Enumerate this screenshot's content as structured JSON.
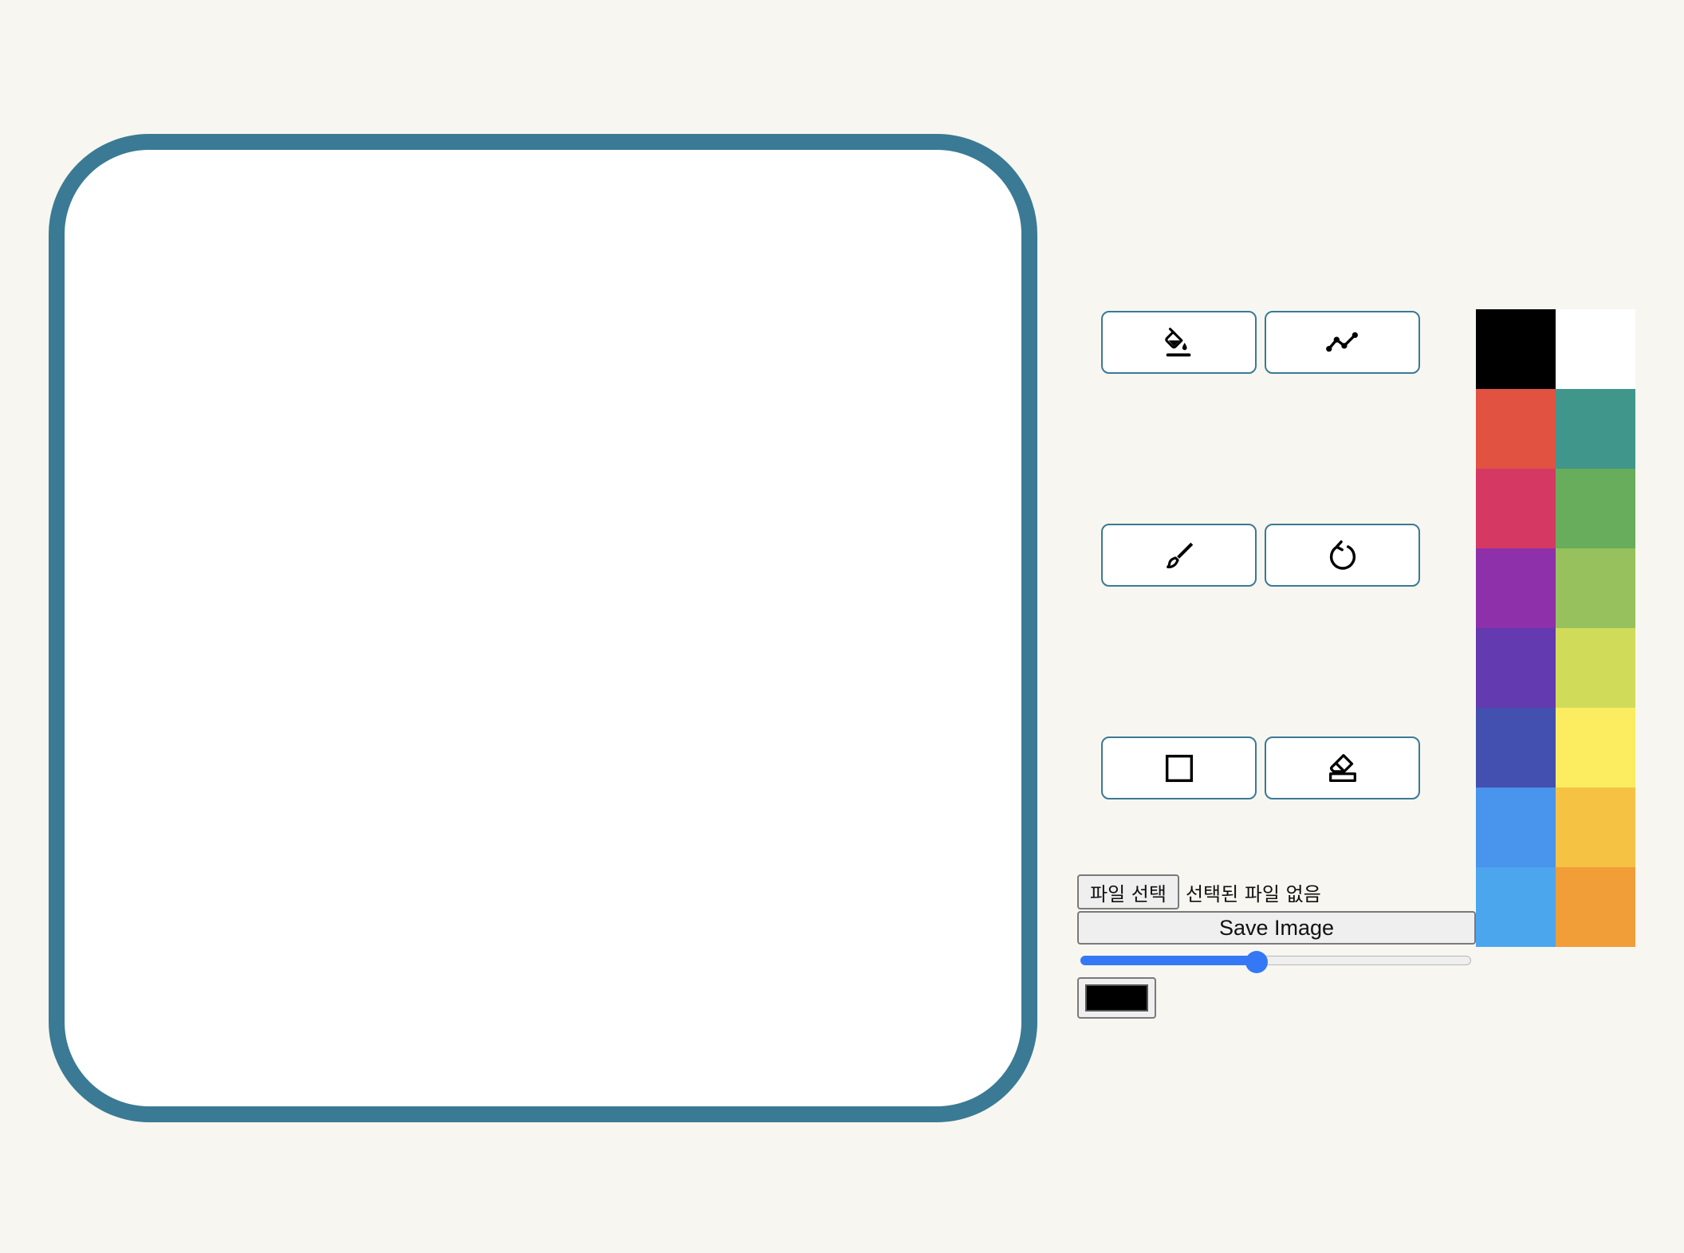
{
  "tools": [
    {
      "name": "fill-tool-button",
      "icon": "paint-bucket-icon"
    },
    {
      "name": "line-tool-button",
      "icon": "polyline-icon"
    },
    {
      "name": "brush-tool-button",
      "icon": "brush-icon"
    },
    {
      "name": "reset-tool-button",
      "icon": "rotate-icon"
    },
    {
      "name": "rectangle-tool-button",
      "icon": "square-icon"
    },
    {
      "name": "eraser-tool-button",
      "icon": "eraser-icon"
    }
  ],
  "file": {
    "button_label": "파일 선택",
    "status": "선택된 파일 없음"
  },
  "save": {
    "label": "Save Image"
  },
  "brush_size": {
    "fraction": 0.45
  },
  "current_color": "#000000",
  "canvas": {
    "border_color": "#3a7a95",
    "background": "#ffffff"
  },
  "palette": [
    "#000000",
    "#ffffff",
    "#e15241",
    "#41968c",
    "#d63864",
    "#67ad5b",
    "#8e30aa",
    "#97c15c",
    "#643ab0",
    "#d0dc59",
    "#4350af",
    "#fcec60",
    "#4994ec",
    "#f6c244",
    "#4ba6ee",
    "#f19d38"
  ]
}
